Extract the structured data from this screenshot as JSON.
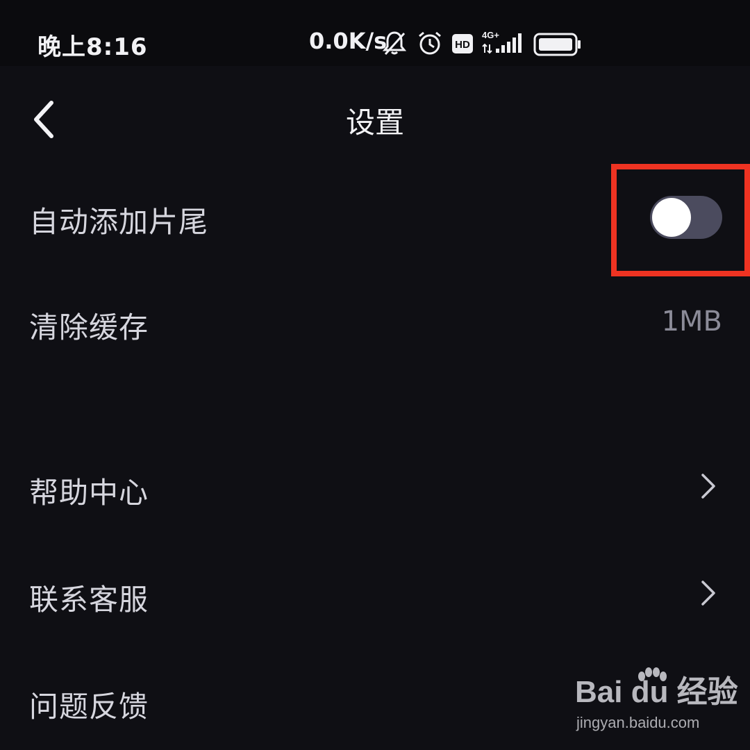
{
  "status_bar": {
    "time": "晚上8:16",
    "net_speed": "0.0K/s",
    "icons": [
      "bell-muted-icon",
      "alarm-icon",
      "hd-icon",
      "signal-4g-icon",
      "battery-icon"
    ],
    "network_label": "4G+",
    "hd_label": "HD"
  },
  "header": {
    "title": "设置",
    "back_icon": "chevron-left-icon"
  },
  "settings": {
    "auto_trailer": {
      "label": "自动添加片尾",
      "enabled": false
    },
    "clear_cache": {
      "label": "清除缓存",
      "value": "1MB"
    },
    "help_center": {
      "label": "帮助中心"
    },
    "contact_service": {
      "label": "联系客服"
    },
    "feedback": {
      "label": "问题反馈"
    }
  },
  "watermark": {
    "logo_text": "Bai du 经验",
    "url": "jingyan.baidu.com"
  },
  "colors": {
    "background": "#0f0f14",
    "status_bar": "#0b0b0e",
    "toggle_track_off": "#4b4b5e",
    "highlight": "#ee3322",
    "secondary_text": "#8b8b98"
  }
}
